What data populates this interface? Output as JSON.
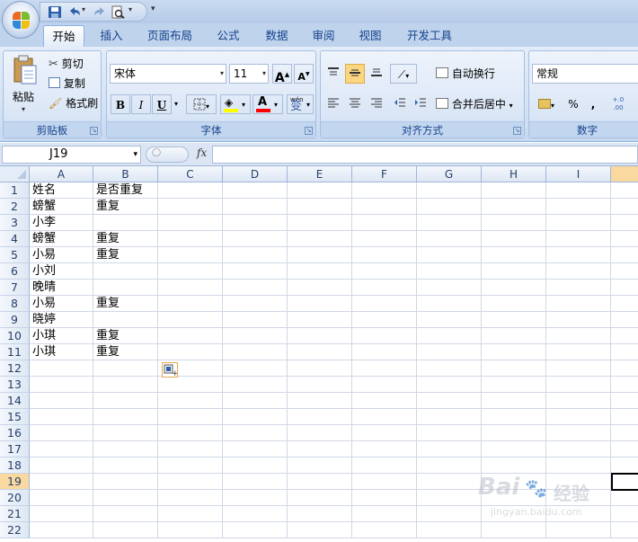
{
  "quick_access": {
    "save_icon": "save-icon",
    "undo_icon": "undo-icon",
    "redo_icon": "redo-icon",
    "print_preview_icon": "print-preview-icon"
  },
  "tabs": [
    {
      "label": "开始",
      "active": true
    },
    {
      "label": "插入"
    },
    {
      "label": "页面布局"
    },
    {
      "label": "公式"
    },
    {
      "label": "数据"
    },
    {
      "label": "审阅"
    },
    {
      "label": "视图"
    },
    {
      "label": "开发工具"
    }
  ],
  "ribbon": {
    "clipboard": {
      "label": "剪贴板",
      "paste": "粘贴",
      "cut": "剪切",
      "copy": "复制",
      "format_painter": "格式刷"
    },
    "font": {
      "label": "字体",
      "font_name": "宋体",
      "font_size": "11",
      "bold": "B",
      "italic": "I",
      "underline": "U",
      "grow": "A",
      "shrink": "A",
      "font_color_letter": "A",
      "phonetic": "wén",
      "phonetic_char": "变",
      "fill_color": "#ffff00",
      "font_color": "#ff0000"
    },
    "alignment": {
      "label": "对齐方式",
      "wrap_text": "自动换行",
      "merge_center": "合并后居中"
    },
    "number": {
      "label": "数字",
      "format": "常规",
      "percent": "%",
      "comma": ",",
      "inc_decimal": "+.0\n.00"
    }
  },
  "formula_bar": {
    "name_box": "J19",
    "fx": "fx",
    "formula": ""
  },
  "sheet": {
    "columns": [
      "A",
      "B",
      "C",
      "D",
      "E",
      "F",
      "G",
      "H",
      "I",
      ""
    ],
    "rows": [
      "1",
      "2",
      "3",
      "4",
      "5",
      "6",
      "7",
      "8",
      "9",
      "10",
      "11",
      "12",
      "13",
      "14",
      "15",
      "16",
      "17",
      "18",
      "19",
      "20",
      "21",
      "22"
    ],
    "cells": [
      [
        "姓名",
        "是否重复"
      ],
      [
        "螃蟹",
        "重复"
      ],
      [
        "小李",
        ""
      ],
      [
        "螃蟹",
        "重复"
      ],
      [
        "小易",
        "重复"
      ],
      [
        "小刘",
        ""
      ],
      [
        "晚晴",
        ""
      ],
      [
        "小易",
        "重复"
      ],
      [
        "晓婷",
        ""
      ],
      [
        "小琪",
        "重复"
      ],
      [
        "小琪",
        "重复"
      ]
    ],
    "selected_column": "J",
    "selected_row": "19",
    "accent_color": "#f9d99f"
  },
  "watermark": {
    "brand": "Bai",
    "brand2": "经验",
    "url": "jingyan.baidu.com"
  }
}
